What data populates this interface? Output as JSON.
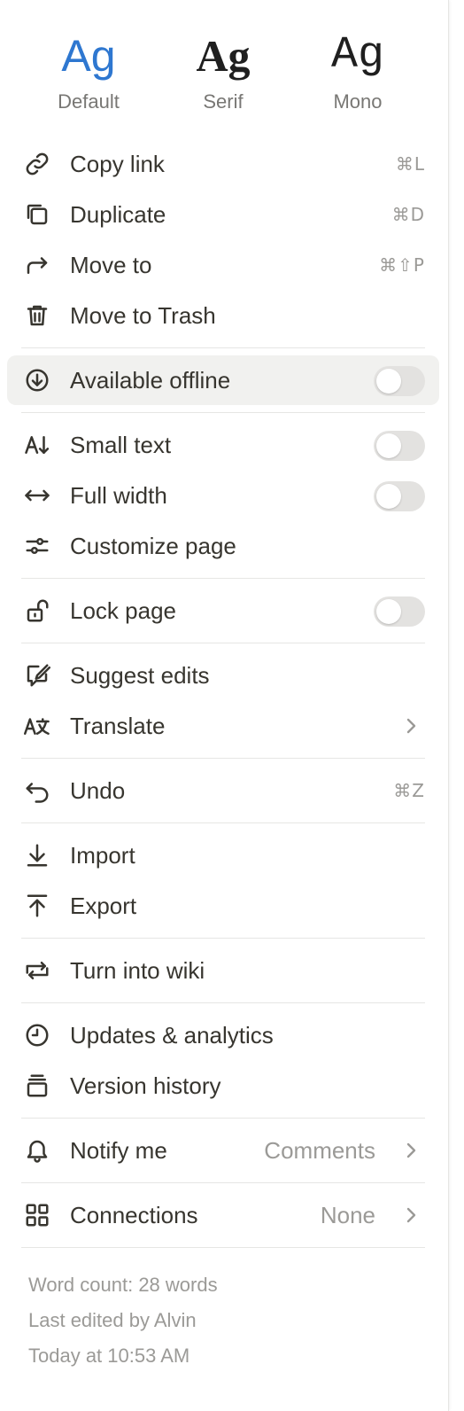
{
  "fonts": [
    {
      "sample": "Ag",
      "label": "Default",
      "selected": true
    },
    {
      "sample": "Ag",
      "label": "Serif",
      "selected": false
    },
    {
      "sample": "Ag",
      "label": "Mono",
      "selected": false
    }
  ],
  "menu": {
    "copy_link": {
      "label": "Copy link",
      "shortcut": "⌘L",
      "icon": "link-icon"
    },
    "duplicate": {
      "label": "Duplicate",
      "shortcut": "⌘D",
      "icon": "duplicate-icon"
    },
    "move_to": {
      "label": "Move to",
      "shortcut": "⌘⇧P",
      "icon": "arrow-turn-right-icon"
    },
    "move_to_trash": {
      "label": "Move to Trash",
      "icon": "trash-icon"
    },
    "available_offline": {
      "label": "Available offline",
      "icon": "download-circle-icon",
      "toggle": false
    },
    "small_text": {
      "label": "Small text",
      "icon": "text-size-down-icon",
      "toggle": false
    },
    "full_width": {
      "label": "Full width",
      "icon": "horizontal-arrows-icon",
      "toggle": false
    },
    "customize_page": {
      "label": "Customize page",
      "icon": "sliders-icon"
    },
    "lock_page": {
      "label": "Lock page",
      "icon": "unlock-icon",
      "toggle": false
    },
    "suggest_edits": {
      "label": "Suggest edits",
      "icon": "suggest-edit-icon"
    },
    "translate": {
      "label": "Translate",
      "icon": "translate-icon"
    },
    "undo": {
      "label": "Undo",
      "shortcut": "⌘Z",
      "icon": "undo-icon"
    },
    "import": {
      "label": "Import",
      "icon": "import-icon"
    },
    "export": {
      "label": "Export",
      "icon": "export-icon"
    },
    "turn_into_wiki": {
      "label": "Turn into wiki",
      "icon": "wiki-convert-icon"
    },
    "updates_analytics": {
      "label": "Updates & analytics",
      "icon": "clock-icon"
    },
    "version_history": {
      "label": "Version history",
      "icon": "version-stack-icon"
    },
    "notify_me": {
      "label": "Notify me",
      "value": "Comments",
      "icon": "bell-icon"
    },
    "connections": {
      "label": "Connections",
      "value": "None",
      "icon": "grid-icon"
    }
  },
  "footer": {
    "word_count": "Word count: 28 words",
    "last_edited": "Last edited by Alvin",
    "timestamp": "Today at 10:53 AM"
  },
  "colors": {
    "accent": "#2e77d0",
    "text": "#37352f",
    "muted": "#9b9a97",
    "toggle_off": "#e3e2e0",
    "hover_bg": "#f1f1ef"
  }
}
